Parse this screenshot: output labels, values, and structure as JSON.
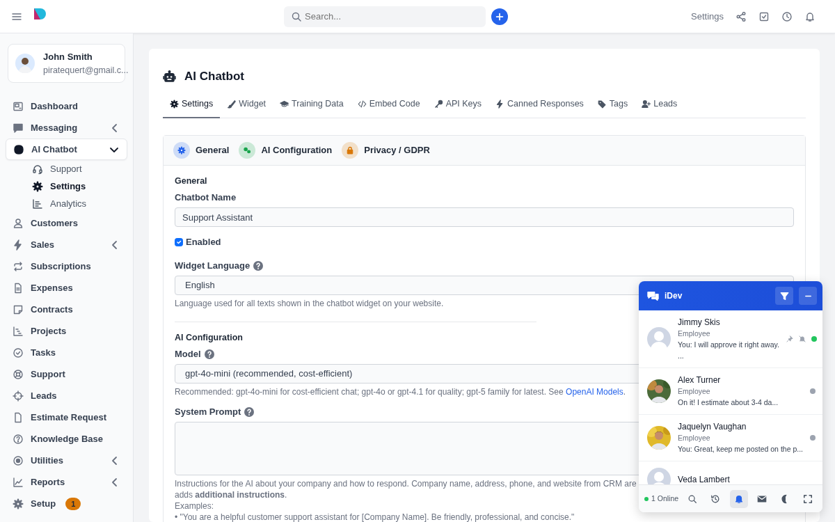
{
  "topbar": {
    "search_placeholder": "Search...",
    "settings_link": "Settings"
  },
  "user": {
    "name": "John Smith",
    "email": "piratequert@gmail.c..."
  },
  "sidebar": {
    "items": [
      {
        "label": "Dashboard",
        "kind": "link",
        "selected": false
      },
      {
        "label": "Messaging",
        "kind": "group",
        "selected": false,
        "expanded": false
      },
      {
        "label": "AI Chatbot",
        "kind": "group",
        "selected": true,
        "expanded": true,
        "children": [
          {
            "label": "Support",
            "selected": false
          },
          {
            "label": "Settings",
            "selected": true
          },
          {
            "label": "Analytics",
            "selected": false
          }
        ]
      },
      {
        "label": "Customers",
        "kind": "link",
        "selected": false
      },
      {
        "label": "Sales",
        "kind": "group",
        "selected": false,
        "expanded": false
      },
      {
        "label": "Subscriptions",
        "kind": "link",
        "selected": false
      },
      {
        "label": "Expenses",
        "kind": "link",
        "selected": false
      },
      {
        "label": "Contracts",
        "kind": "link",
        "selected": false
      },
      {
        "label": "Projects",
        "kind": "link",
        "selected": false
      },
      {
        "label": "Tasks",
        "kind": "link",
        "selected": false
      },
      {
        "label": "Support",
        "kind": "link",
        "selected": false
      },
      {
        "label": "Leads",
        "kind": "link",
        "selected": false
      },
      {
        "label": "Estimate Request",
        "kind": "link",
        "selected": false
      },
      {
        "label": "Knowledge Base",
        "kind": "link",
        "selected": false
      },
      {
        "label": "Utilities",
        "kind": "group",
        "selected": false,
        "expanded": false
      },
      {
        "label": "Reports",
        "kind": "group",
        "selected": false,
        "expanded": false
      },
      {
        "label": "Setup",
        "kind": "link",
        "selected": false,
        "badge": "1"
      }
    ]
  },
  "page": {
    "title": "AI Chatbot",
    "tabs": [
      {
        "label": "Settings",
        "selected": true
      },
      {
        "label": "Widget",
        "selected": false
      },
      {
        "label": "Training Data",
        "selected": false
      },
      {
        "label": "Embed Code",
        "selected": false
      },
      {
        "label": "API Keys",
        "selected": false
      },
      {
        "label": "Canned Responses",
        "selected": false
      },
      {
        "label": "Tags",
        "selected": false
      },
      {
        "label": "Leads",
        "selected": false
      }
    ],
    "sections_nav": [
      {
        "label": "General",
        "color": "#2563eb"
      },
      {
        "label": "AI Configuration",
        "color": "#16a34a"
      },
      {
        "label": "Privacy / GDPR",
        "color": "#d97706"
      }
    ],
    "form": {
      "general_heading": "General",
      "name_label": "Chatbot Name",
      "name_value": "Support Assistant",
      "enabled_label": "Enabled",
      "enabled_checked": true,
      "language_label": "Widget Language",
      "language_value": "English",
      "language_help": "Language used for all texts shown in the chatbot widget on your website.",
      "ai_heading": "AI Configuration",
      "model_label": "Model",
      "model_value": "gpt-4o-mini (recommended, cost-efficient)",
      "model_help": "Recommended: gpt-4o-mini for cost-efficient chat; gpt-4o or gpt-4.1 for quality; gpt-5 family for latest. See ",
      "model_help_link": "OpenAI Models",
      "model_help_end": ".",
      "prompt_label": "System Prompt",
      "prompt_help_1": "Instructions for the AI about your company and how to respond. Company name, address, phone, and website from CRM are",
      "prompt_help_2": "adds **additional instructions**.",
      "examples_label": "Examples:",
      "example_1": "• \"You are a helpful customer support assistant for [Company Name]. Be friendly, professional, and concise.\""
    }
  },
  "chat": {
    "title": "iDev",
    "conversations": [
      {
        "name": "Jimmy Skis",
        "role": "Employee",
        "message": "You: I will approve it right away.",
        "continuation": "...",
        "kind": "placeholder",
        "pinned": true,
        "muted": true,
        "color": "#22c55e"
      },
      {
        "name": "Alex Turner",
        "role": "Employee",
        "message": "On it! I estimate about 3-4 da...",
        "pinned": false,
        "muted": false,
        "color": "#9ca3af"
      },
      {
        "name": "Jaquelyn Vaughan",
        "role": "Employee",
        "message": "You: Great, keep me posted on the p...",
        "pinned": false,
        "muted": false,
        "color": "#9ca3af"
      },
      {
        "name": "Veda Lambert",
        "kind": "placeholder"
      }
    ],
    "online": "1 Online",
    "footer_buttons": [
      {
        "selected": false
      },
      {
        "selected": false
      },
      {
        "selected": true
      },
      {
        "selected": false
      },
      {
        "selected": false
      },
      {
        "selected": false
      }
    ]
  }
}
